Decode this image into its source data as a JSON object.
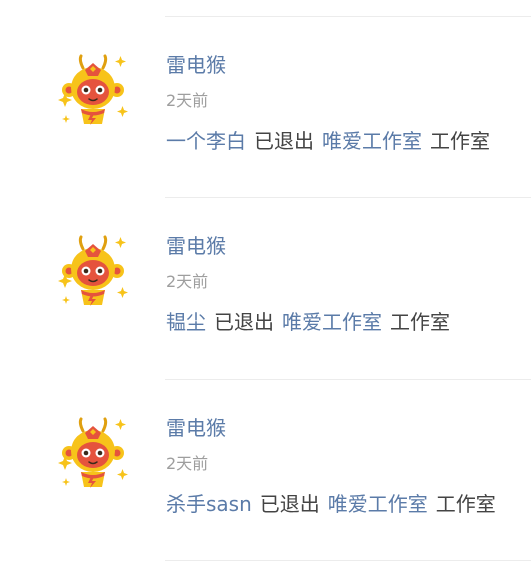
{
  "feed": {
    "items": [
      {
        "author": "雷电猴",
        "time": "2天前",
        "user": "一个李白",
        "action": "已退出",
        "group": "唯爱工作室",
        "suffix": "工作室",
        "avatar_icon": "monkey-avatar-icon"
      },
      {
        "author": "雷电猴",
        "time": "2天前",
        "user": "韫尘",
        "action": "已退出",
        "group": "唯爱工作室",
        "suffix": "工作室",
        "avatar_icon": "monkey-avatar-icon"
      },
      {
        "author": "雷电猴",
        "time": "2天前",
        "user": "杀手sasn",
        "action": "已退出",
        "group": "唯爱工作室",
        "suffix": "工作室",
        "avatar_icon": "monkey-avatar-icon"
      }
    ]
  },
  "colors": {
    "link": "#5b7ba8",
    "text": "#444444",
    "muted": "#9e9e9e",
    "divider": "#ececec",
    "avatar_yellow": "#f7c31a",
    "avatar_red": "#e5533d"
  }
}
